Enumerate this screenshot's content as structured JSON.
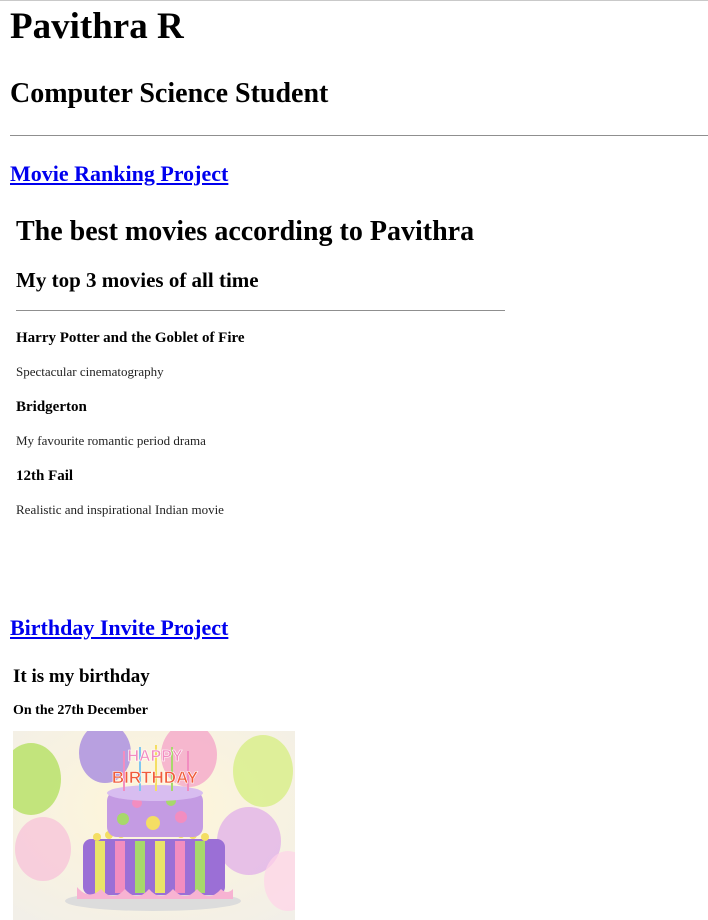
{
  "profile": {
    "name": "Pavithra R",
    "role": "Computer Science Student"
  },
  "projects": {
    "movie": {
      "link_label": "Movie Ranking Project",
      "title": "The best movies according to Pavithra",
      "subtitle": "My top 3 movies of all time",
      "movies": [
        {
          "title": "Harry Potter and the Goblet of Fire",
          "description": "Spectacular cinematography"
        },
        {
          "title": "Bridgerton",
          "description": "My favourite romantic period drama"
        },
        {
          "title": "12th Fail",
          "description": "Realistic and inspirational Indian movie"
        }
      ]
    },
    "birthday": {
      "link_label": "Birthday Invite Project",
      "title": "It is my birthday",
      "date_line": "On the 27th December",
      "image_banner_top": "HAPPY",
      "image_banner_bottom": "BIRTHDAY"
    }
  },
  "colors": {
    "link": "#0000ee",
    "rule": "#8f8f8f"
  }
}
